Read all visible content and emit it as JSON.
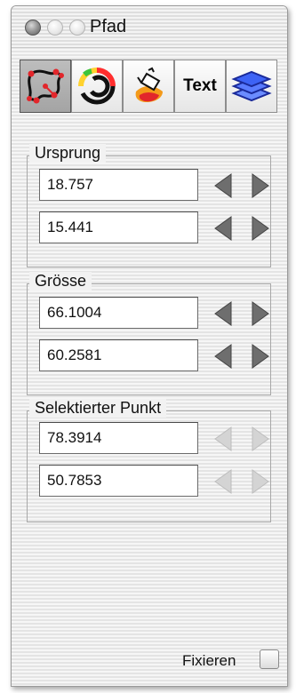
{
  "window": {
    "title": "Pfad"
  },
  "toolbar": {
    "tools": [
      {
        "name": "path",
        "icon": "path-edit-icon",
        "active": true
      },
      {
        "name": "color",
        "icon": "color-wheel-icon",
        "active": false
      },
      {
        "name": "fill",
        "icon": "paint-bucket-icon",
        "active": false
      },
      {
        "name": "text",
        "label": "Text",
        "active": false
      },
      {
        "name": "layers",
        "icon": "layers-icon",
        "active": false
      }
    ]
  },
  "groups": {
    "ursprung": {
      "label": "Ursprung",
      "fields": [
        "18.757",
        "15.441"
      ]
    },
    "groesse": {
      "label": "Grösse",
      "fields": [
        "66.1004",
        "60.2581"
      ]
    },
    "selektierter_punkt": {
      "label": "Selektierter Punkt",
      "fields": [
        "78.3914",
        "50.7853"
      ],
      "arrows_enabled": false
    }
  },
  "fixieren": {
    "label": "Fixieren",
    "checked": false
  },
  "colors": {
    "arrow_enabled": "#6e6e6e",
    "arrow_disabled": "#cfcfcf",
    "path_red": "#e2262b"
  }
}
